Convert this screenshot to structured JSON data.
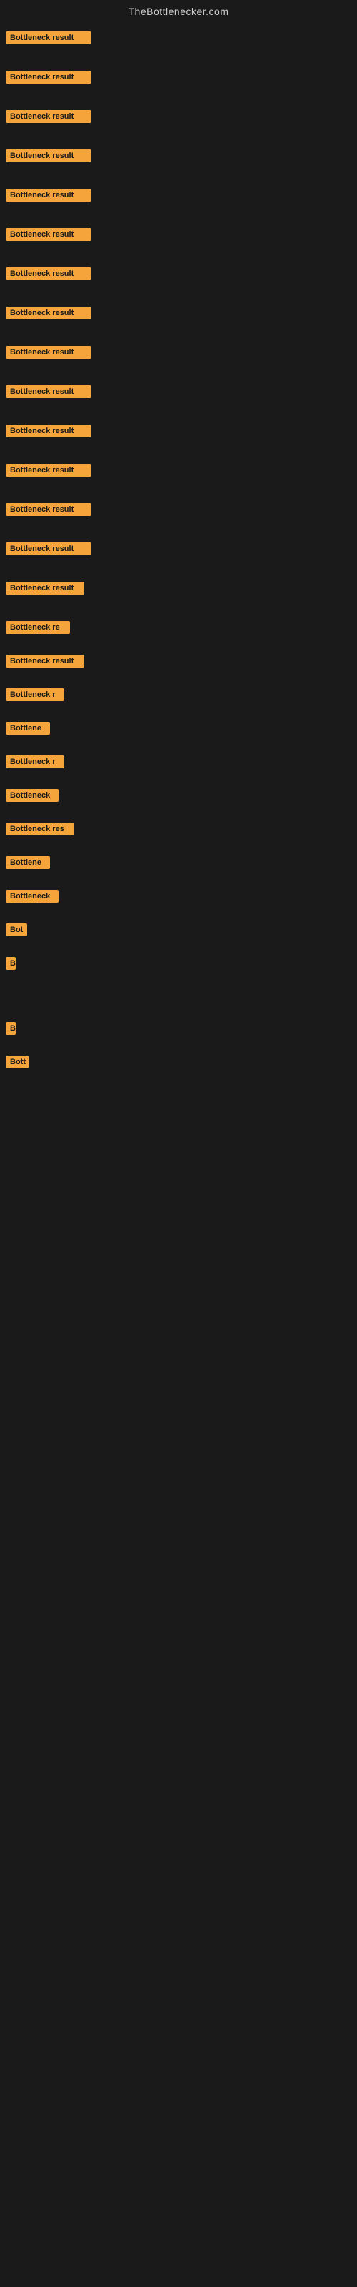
{
  "header": {
    "title": "TheBottlenecker.com"
  },
  "labels": [
    {
      "text": "Bottleneck result",
      "width": 120,
      "marginTop": 8
    },
    {
      "text": "Bottleneck result",
      "width": 120,
      "marginTop": 28
    },
    {
      "text": "Bottleneck result",
      "width": 120,
      "marginTop": 28
    },
    {
      "text": "Bottleneck result",
      "width": 120,
      "marginTop": 28
    },
    {
      "text": "Bottleneck result",
      "width": 120,
      "marginTop": 28
    },
    {
      "text": "Bottleneck result",
      "width": 120,
      "marginTop": 28
    },
    {
      "text": "Bottleneck result",
      "width": 120,
      "marginTop": 28
    },
    {
      "text": "Bottleneck result",
      "width": 120,
      "marginTop": 28
    },
    {
      "text": "Bottleneck result",
      "width": 120,
      "marginTop": 28
    },
    {
      "text": "Bottleneck result",
      "width": 120,
      "marginTop": 28
    },
    {
      "text": "Bottleneck result",
      "width": 120,
      "marginTop": 28
    },
    {
      "text": "Bottleneck result",
      "width": 120,
      "marginTop": 28
    },
    {
      "text": "Bottleneck result",
      "width": 120,
      "marginTop": 28
    },
    {
      "text": "Bottleneck result",
      "width": 120,
      "marginTop": 28
    },
    {
      "text": "Bottleneck result",
      "width": 110,
      "marginTop": 28
    },
    {
      "text": "Bottleneck re",
      "width": 90,
      "marginTop": 28
    },
    {
      "text": "Bottleneck result",
      "width": 110,
      "marginTop": 20
    },
    {
      "text": "Bottleneck r",
      "width": 82,
      "marginTop": 20
    },
    {
      "text": "Bottlene",
      "width": 62,
      "marginTop": 20
    },
    {
      "text": "Bottleneck r",
      "width": 82,
      "marginTop": 20
    },
    {
      "text": "Bottleneck",
      "width": 74,
      "marginTop": 20
    },
    {
      "text": "Bottleneck res",
      "width": 95,
      "marginTop": 20
    },
    {
      "text": "Bottlene",
      "width": 62,
      "marginTop": 20
    },
    {
      "text": "Bottleneck",
      "width": 74,
      "marginTop": 20
    },
    {
      "text": "Bot",
      "width": 30,
      "marginTop": 20
    },
    {
      "text": "B",
      "width": 14,
      "marginTop": 20
    },
    {
      "text": "",
      "width": 0,
      "marginTop": 30
    },
    {
      "text": "B",
      "width": 14,
      "marginTop": 30
    },
    {
      "text": "Bott",
      "width": 32,
      "marginTop": 20
    }
  ]
}
